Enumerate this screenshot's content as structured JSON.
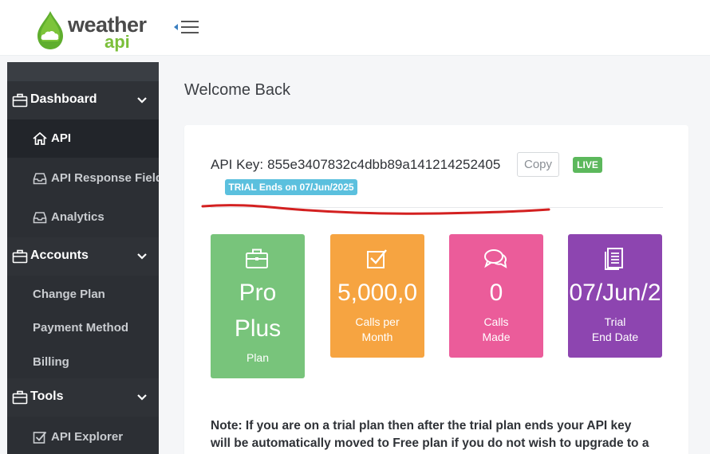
{
  "brand": {
    "logo_word1": "weather",
    "logo_word2": "api",
    "colors": {
      "green": "#7bbf3a",
      "dark": "#4a4a4a"
    }
  },
  "header": {
    "menu_toggle_icon": "hamburger-menu-icon"
  },
  "sidebar": {
    "sections": [
      {
        "label": "Dashboard",
        "icon": "briefcase-icon",
        "items": [
          {
            "label": "API",
            "icon": "home-icon",
            "active": true
          },
          {
            "label": "API Response Fields",
            "icon": "inbox-icon"
          },
          {
            "label": "Analytics",
            "icon": "inbox-icon"
          }
        ]
      },
      {
        "label": "Accounts",
        "icon": "briefcase-icon",
        "items": [
          {
            "label": "Change Plan"
          },
          {
            "label": "Payment Method"
          },
          {
            "label": "Billing"
          }
        ]
      },
      {
        "label": "Tools",
        "icon": "briefcase-icon",
        "items": [
          {
            "label": "API Explorer",
            "icon": "checkbox-icon"
          }
        ]
      }
    ]
  },
  "main": {
    "title": "Welcome Back",
    "api_key": {
      "label": "API Key:",
      "value": "855e3407832c4dbb89a141214252405",
      "copy_label": "Copy",
      "status_badge": "LIVE",
      "trial_badge": "TRIAL Ends on 07/Jun/2025"
    },
    "stats": [
      {
        "value_line1": "Pro",
        "value_line2": "Plus",
        "caption_line1": "Plan",
        "caption_line2": "",
        "color": "#78c47b",
        "icon": "briefcase-icon"
      },
      {
        "value_line1": "5,000,0",
        "value_line2": "",
        "caption_line1": "Calls per",
        "caption_line2": "Month",
        "color": "#f6a441",
        "icon": "checkbox-icon"
      },
      {
        "value_line1": "0",
        "value_line2": "",
        "caption_line1": "Calls",
        "caption_line2": "Made",
        "color": "#eb5c9a",
        "icon": "chat-bubbles-icon"
      },
      {
        "value_line1": "07/Jun/2",
        "value_line2": "",
        "caption_line1": "Trial",
        "caption_line2": "End Date",
        "color": "#8d45b0",
        "icon": "document-icon"
      }
    ],
    "note_line1": "Note: If you are on a trial plan then after the trial plan ends your API key",
    "note_line2": "will be automatically moved to Free plan if you do not wish to upgrade to a"
  }
}
